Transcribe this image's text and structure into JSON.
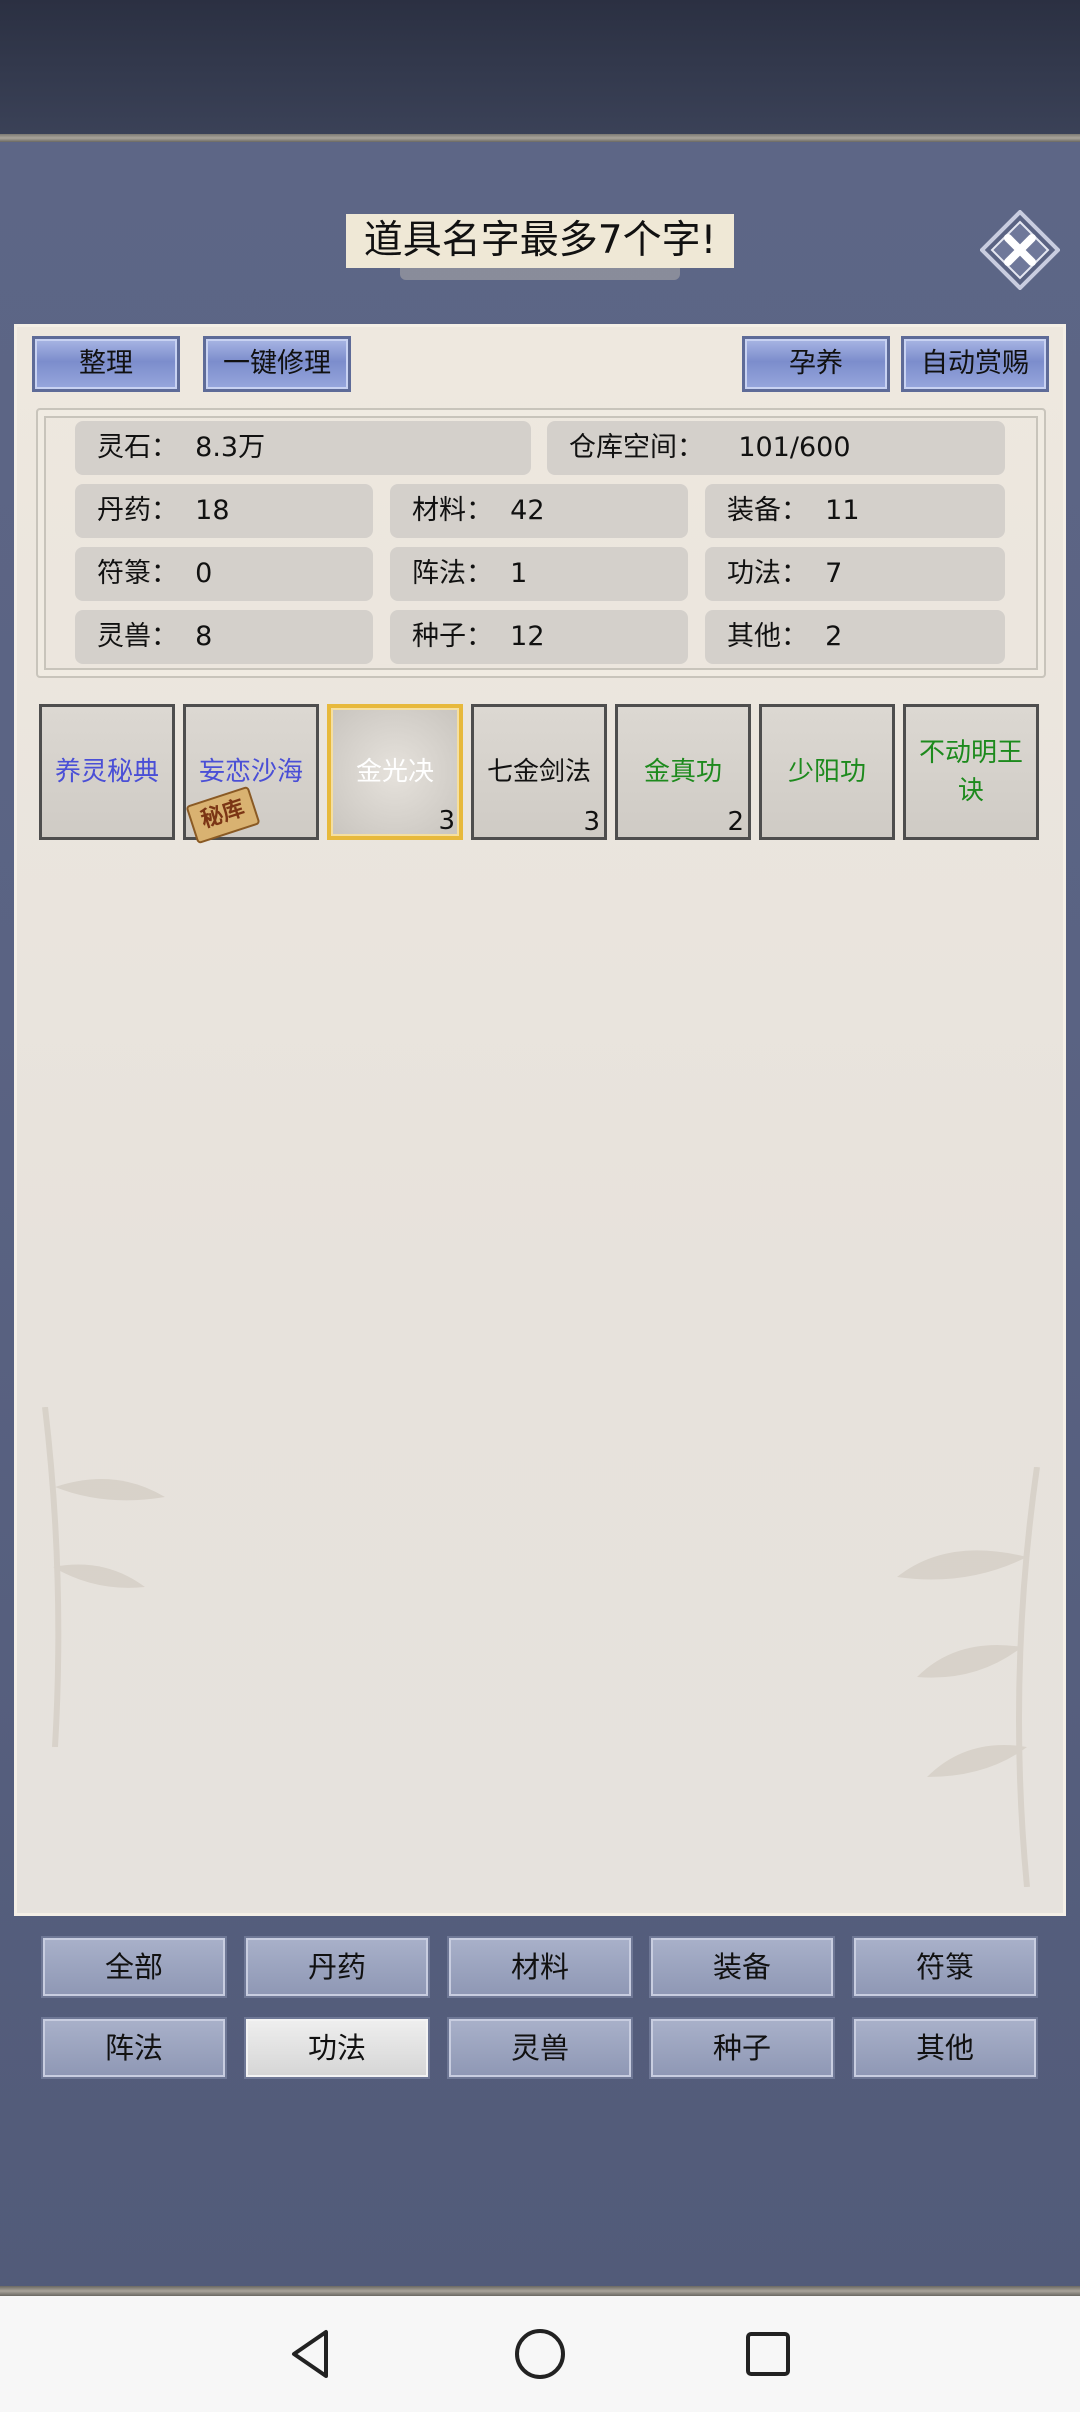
{
  "header": {
    "title": "道具名字最多7个字!"
  },
  "toolbar": {
    "sort_label": "整理",
    "repair_label": "一键修理",
    "nurture_label": "孕养",
    "auto_reward_label": "自动赏赐"
  },
  "stats": {
    "spirit_stone": "灵石：  8.3万",
    "storage": "仓库空间：    101/600",
    "pills": "丹药：  18",
    "materials": "材料：  42",
    "equipment": "装备：  11",
    "talismans": "符箓：  0",
    "formations": "阵法：  1",
    "techniques": "功法：  7",
    "beasts": "灵兽：  8",
    "seeds": "种子：  12",
    "others": "其他：  2"
  },
  "items": [
    {
      "name": "养灵秘典",
      "count": "",
      "color": "#4a4fd6"
    },
    {
      "name": "妄恋沙海",
      "count": "",
      "color": "#4a4fd6",
      "stamp": "秘库"
    },
    {
      "name": "金光决",
      "count": "3",
      "color": "#ffffff"
    },
    {
      "name": "七金剑法",
      "count": "3",
      "color": "#111111"
    },
    {
      "name": "金真功",
      "count": "2",
      "color": "#1d8a1d"
    },
    {
      "name": "少阳功",
      "count": "",
      "color": "#1d8a1d"
    },
    {
      "name": "不动明王诀",
      "count": "",
      "color": "#1d8a1d"
    }
  ],
  "categories": {
    "all": "全部",
    "pills": "丹药",
    "materials": "材料",
    "equipment": "装备",
    "talismans": "符箓",
    "formations": "阵法",
    "techniques": "功法",
    "beasts": "灵兽",
    "seeds": "种子",
    "others": "其他",
    "active": "功法"
  },
  "icons": {
    "close": "close-icon",
    "back": "nav-back-icon",
    "home": "nav-home-icon",
    "recents": "nav-recents-icon"
  },
  "colors": {
    "panel_bg": "#5d6686",
    "content_bg": "#eee8df",
    "button_blue": "#8c9bd6",
    "selected_border": "#e7b93c"
  }
}
